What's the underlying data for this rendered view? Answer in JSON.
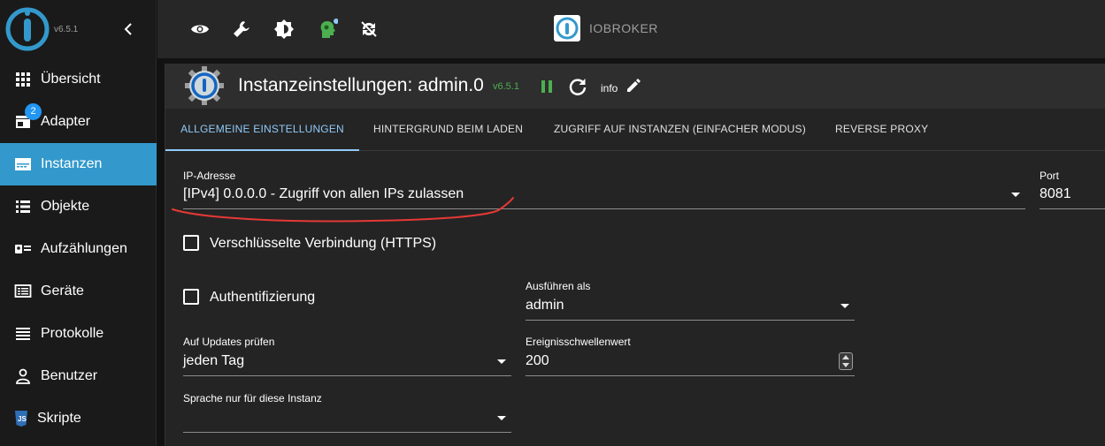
{
  "sidebar": {
    "version": "v6.5.1",
    "badge": "2",
    "items": [
      {
        "label": "Übersicht",
        "icon": "grid-icon"
      },
      {
        "label": "Adapter",
        "icon": "store-icon"
      },
      {
        "label": "Instanzen",
        "icon": "instances-icon"
      },
      {
        "label": "Objekte",
        "icon": "list-icon"
      },
      {
        "label": "Aufzählungen",
        "icon": "enum-icon"
      },
      {
        "label": "Geräte",
        "icon": "devices-icon"
      },
      {
        "label": "Protokolle",
        "icon": "log-icon"
      },
      {
        "label": "Benutzer",
        "icon": "user-icon"
      },
      {
        "label": "Skripte",
        "icon": "js-icon"
      }
    ]
  },
  "topbar": {
    "brand": "IOBROKER",
    "icons": [
      "eye-icon",
      "wrench-icon",
      "brightness-icon",
      "expert-mode-icon",
      "sync-icon"
    ]
  },
  "panel": {
    "title": "Instanzeinstellungen: admin.0",
    "version": "v6.5.1",
    "info": "info",
    "tabs": [
      "ALLGEMEINE EINSTELLUNGEN",
      "HINTERGRUND BEIM LADEN",
      "ZUGRIFF AUF INSTANZEN (EINFACHER MODUS)",
      "REVERSE PROXY"
    ],
    "form": {
      "ip_label": "IP-Adresse",
      "ip_value": "[IPv4] 0.0.0.0 - Zugriff von allen IPs zulassen",
      "port_label": "Port",
      "port_value": "8081",
      "https_label": "Verschlüsselte Verbindung (HTTPS)",
      "auth_label": "Authentifizierung",
      "run_as_label": "Ausführen als",
      "run_as_value": "admin",
      "updates_label": "Auf Updates prüfen",
      "updates_value": "jeden Tag",
      "threshold_label": "Ereignisschwellenwert",
      "threshold_value": "200",
      "language_label": "Sprache nur für diese Instanz",
      "language_value": ""
    }
  },
  "colors": {
    "accent": "#3399cc",
    "tab_active": "#90caf9",
    "version_green": "#4caf50",
    "annotation": "#e53935"
  }
}
